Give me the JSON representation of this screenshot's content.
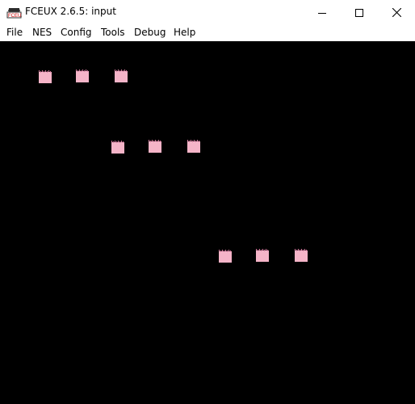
{
  "window": {
    "title": "FCEUX 2.6.5: input",
    "app_icon": "fceux-logo-icon",
    "controls": {
      "minimize_icon": "minimize-icon",
      "maximize_icon": "maximize-icon",
      "close_icon": "close-icon"
    }
  },
  "menu": {
    "file": "File",
    "nes": "NES",
    "config": "Config",
    "tools": "Tools",
    "debug": "Debug",
    "help": "Help"
  },
  "game_screen": {
    "background_color": "#000000",
    "sprite_color": "#f5b4c8",
    "sprite_shade_color": "#d87aa0",
    "sprite_groups": 3,
    "sprites_per_group": 3
  }
}
